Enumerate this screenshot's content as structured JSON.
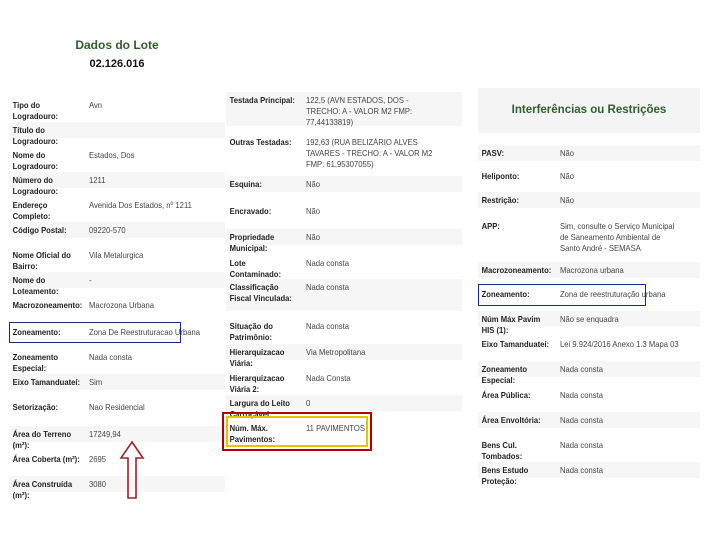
{
  "left": {
    "title": "Dados do Lote",
    "lot_number": "02.126.016",
    "rows": [
      {
        "label": "Tipo do Logradouro:",
        "value": "Avn"
      },
      {
        "label": "Título do Logradouro:",
        "value": ""
      },
      {
        "label": "Nome do Logradouro:",
        "value": "Estados, Dos"
      },
      {
        "label": "Número do Logradouro:",
        "value": "1211"
      },
      {
        "label": "Endereço Completo:",
        "value": "Avenida Dos Estados, nº 1211"
      },
      {
        "label": "Código Postal:",
        "value": "09220-570"
      },
      {
        "label": "Nome Oficial do Bairro:",
        "value": "Vila Metalurgica"
      },
      {
        "label": "Nome do Loteamento:",
        "value": "-"
      },
      {
        "label": "Macrozoneamento:",
        "value": "Macrozona Urbana"
      },
      {
        "label": "Zoneamento:",
        "value": "Zona De Reestruturacao Urbana"
      },
      {
        "label": "Zoneamento Especial:",
        "value": "Nada consta"
      },
      {
        "label": "Eixo Tamanduateí:",
        "value": "Sim"
      },
      {
        "label": "Setorização:",
        "value": "Nao Residencial"
      },
      {
        "label": "Área do Terreno (m²):",
        "value": "17249,94"
      },
      {
        "label": "Área Coberta (m²):",
        "value": "2695"
      },
      {
        "label": "Área Construída (m²):",
        "value": "3080"
      }
    ]
  },
  "middle": {
    "rows": [
      {
        "label": "Testada Principal:",
        "value": "122,5 (AVN ESTADOS, DOS - TRECHO: A - VALOR M2 FMP: 77,44133819)"
      },
      {
        "label": "Outras Testadas:",
        "value": "192,63 (RUA BELIZÁRIO ALVES TAVARES - TRECHO: A - VALOR M2 FMP: 61,95307055)"
      },
      {
        "label": "Esquina:",
        "value": "Não"
      },
      {
        "label": "Encravado:",
        "value": "Não"
      },
      {
        "label": "Propriedade Municipal:",
        "value": "Não"
      },
      {
        "label": "Lote Contaminado:",
        "value": "Nada consta"
      },
      {
        "label": "Classificação Fiscal Vinculada:",
        "value": "Nada consta"
      },
      {
        "label": "Situação do Patrimônio:",
        "value": "Nada consta"
      },
      {
        "label": "Hierarquizacao Viária:",
        "value": "Via Metropolitana"
      },
      {
        "label": "Hierarquizacao Viária 2:",
        "value": "Nada Consta"
      },
      {
        "label": "Largura do Leito Carroçável:",
        "value": "0"
      },
      {
        "label": "Núm. Máx. Pavimentos:",
        "value": "11 PAVIMENTOS"
      }
    ]
  },
  "right": {
    "title": "Interferências ou Restrições",
    "rows": [
      {
        "label": "PASV:",
        "value": "Não"
      },
      {
        "label": "Heliponto:",
        "value": "Não"
      },
      {
        "label": "Restrição:",
        "value": "Não"
      },
      {
        "label": "APP:",
        "value": "Sim, consulte o Serviço Municipal de Saneamento Ambiental de Santo André - SEMASA"
      },
      {
        "label": "Macrozoneamento:",
        "value": "Macrozona urbana"
      },
      {
        "label": "Zoneamento:",
        "value": "Zona de reestruturação urbana"
      },
      {
        "label": "Núm Máx Pavim HIS (1):",
        "value": "Não se enquadra"
      },
      {
        "label": "Eixo Tamanduateí:",
        "value": "Lei 9.924/2016 Anexo 1.3 Mapa 03"
      },
      {
        "label": "Zoneamento Especial:",
        "value": "Nada consta"
      },
      {
        "label": "Área Pública:",
        "value": "Nada consta"
      },
      {
        "label": "Área Envoltória:",
        "value": "Nada consta"
      },
      {
        "label": "Bens Cul. Tombados:",
        "value": "Nada consta"
      },
      {
        "label": "Bens Estudo Proteção:",
        "value": "Nada consta"
      }
    ]
  },
  "colors": {
    "title": "#2f5e2f",
    "highlight_blue": "#1a2a8a",
    "highlight_red": "#b00000",
    "highlight_yellow": "#e6c200",
    "arrow": "#a0212a"
  }
}
